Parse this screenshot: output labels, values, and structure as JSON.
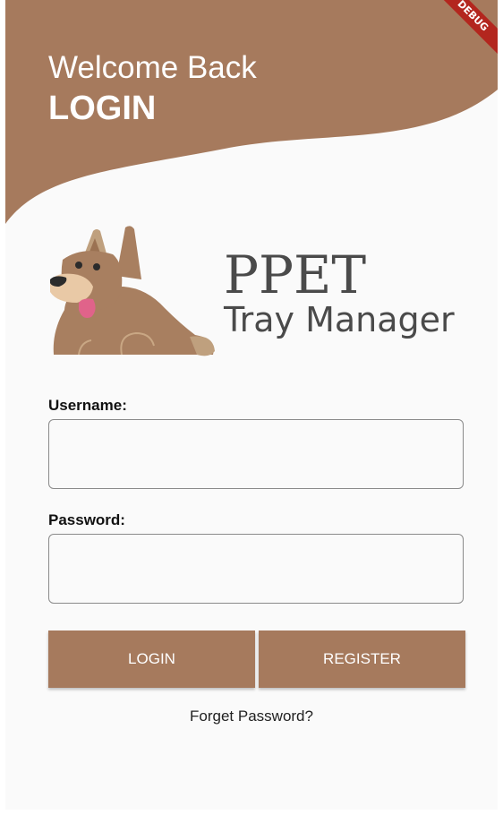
{
  "header": {
    "welcome": "Welcome Back",
    "title": "LOGIN",
    "debug_banner": "DEBUG"
  },
  "logo": {
    "icon": "dog-icon",
    "app_name": "PPET",
    "app_subtitle": "Tray Manager"
  },
  "form": {
    "username_label": "Username:",
    "username_value": "",
    "password_label": "Password:",
    "password_value": ""
  },
  "buttons": {
    "login": "LOGIN",
    "register": "REGISTER"
  },
  "links": {
    "forgot": "Forget Password?"
  },
  "colors": {
    "brand": "#a67a5d",
    "background": "#fafafa",
    "debug_banner": "#b3261e"
  }
}
